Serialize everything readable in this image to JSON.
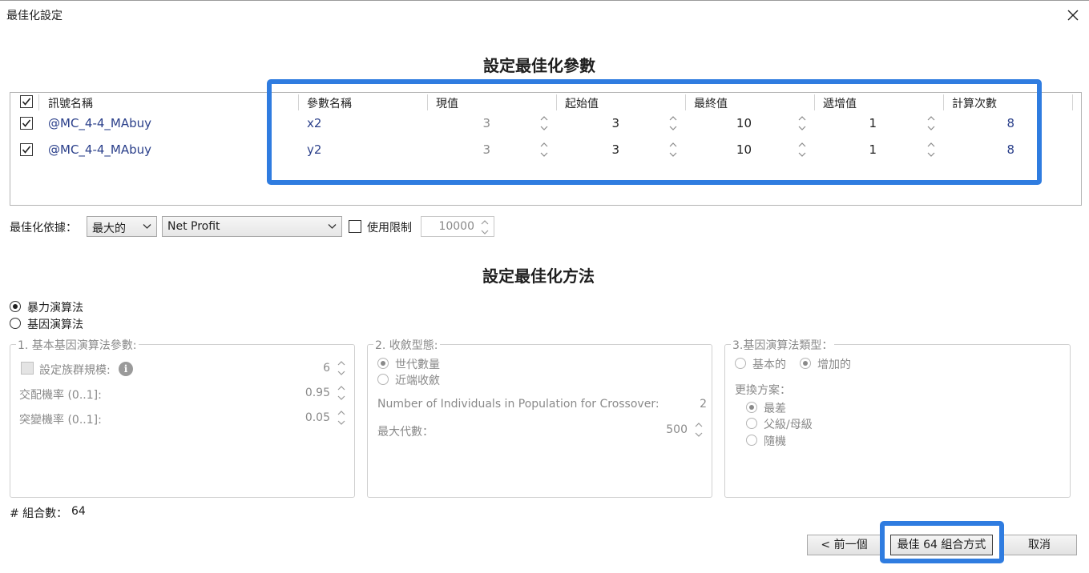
{
  "window": {
    "title": "最佳化設定",
    "close_icon": "close-icon"
  },
  "params_section": {
    "title": "設定最佳化參數"
  },
  "grid": {
    "headers": {
      "signal_name": "訊號名稱",
      "param_name": "參數名稱",
      "current": "現值",
      "start": "起始值",
      "end": "最終值",
      "step": "遞增值",
      "count": "計算次數"
    },
    "header_checked": true,
    "rows": [
      {
        "checked": true,
        "signal": "@MC_4-4_MAbuy",
        "param": "x2",
        "current": "3",
        "start": "3",
        "end": "10",
        "step": "1",
        "count": "8"
      },
      {
        "checked": true,
        "signal": "@MC_4-4_MAbuy",
        "param": "y2",
        "current": "3",
        "start": "3",
        "end": "10",
        "step": "1",
        "count": "8"
      }
    ]
  },
  "criteria": {
    "label": "最佳化依據：",
    "direction": "最大的",
    "metric": "Net Profit",
    "limit_label": "使用限制",
    "limit_checked": false,
    "limit_value": "10000"
  },
  "method_section": {
    "title": "設定最佳化方法"
  },
  "methods": {
    "brute_force": "暴力演算法",
    "genetic": "基因演算法",
    "selected": "brute_force"
  },
  "genetic_params": {
    "title": "1. 基本基因演算法參數:",
    "population_label": "設定族群規模:",
    "population_value": "6",
    "crossover_label": "交配機率 (0..1]:",
    "crossover_value": "0.95",
    "mutation_label": "突變機率 (0..1]:",
    "mutation_value": "0.05"
  },
  "convergence": {
    "title": "2. 收斂型態:",
    "generations": "世代數量",
    "extreme": "近端收斂",
    "individuals_label": "Number of Individuals in Population for Crossover:",
    "individuals_value": "2",
    "max_gen_label": "最大代數：",
    "max_gen_value": "500"
  },
  "ga_type": {
    "title": "3.基因演算法類型：",
    "basic": "基本的",
    "incremental": "增加的",
    "replace_label": "更換方案：",
    "worst": "最差",
    "parent": "父級/母級",
    "random": "隨機"
  },
  "combinations": {
    "label": "# 組合數：",
    "value": "64"
  },
  "buttons": {
    "prev": "< 前一個",
    "run": "最佳 64 組合方式",
    "cancel": "取消"
  },
  "highlight_color": "#2f7ce0"
}
